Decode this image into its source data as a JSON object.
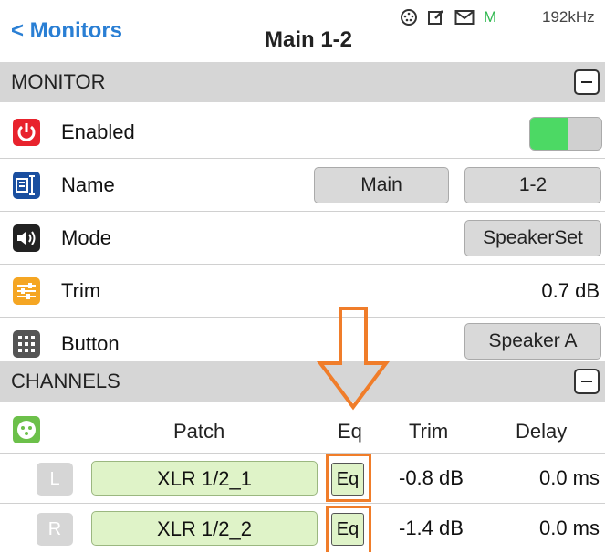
{
  "header": {
    "back_label": "< Monitors",
    "title": "Main 1-2",
    "status_m": "M",
    "sample_rate": "192kHz"
  },
  "monitor_section": {
    "title": "MONITOR",
    "rows": {
      "enabled": {
        "label": "Enabled",
        "on": true
      },
      "name": {
        "label": "Name",
        "value1": "Main",
        "value2": "1-2"
      },
      "mode": {
        "label": "Mode",
        "value": "SpeakerSet"
      },
      "trim": {
        "label": "Trim",
        "value": "0.7 dB"
      },
      "button": {
        "label": "Button",
        "value": "Speaker A"
      }
    }
  },
  "channels_section": {
    "title": "CHANNELS",
    "columns": {
      "patch": "Patch",
      "eq": "Eq",
      "trim": "Trim",
      "delay": "Delay"
    },
    "channels": [
      {
        "name": "L",
        "patch": "XLR 1/2_1",
        "eq": "Eq",
        "trim": "-0.8 dB",
        "delay": "0.0 ms"
      },
      {
        "name": "R",
        "patch": "XLR 1/2_2",
        "eq": "Eq",
        "trim": "-1.4 dB",
        "delay": "0.0 ms"
      }
    ]
  },
  "colors": {
    "accent": "#2a7fd4",
    "toggle_on": "#4cd964",
    "highlight": "#f07d2a",
    "patch_bg": "#dff3c8"
  }
}
